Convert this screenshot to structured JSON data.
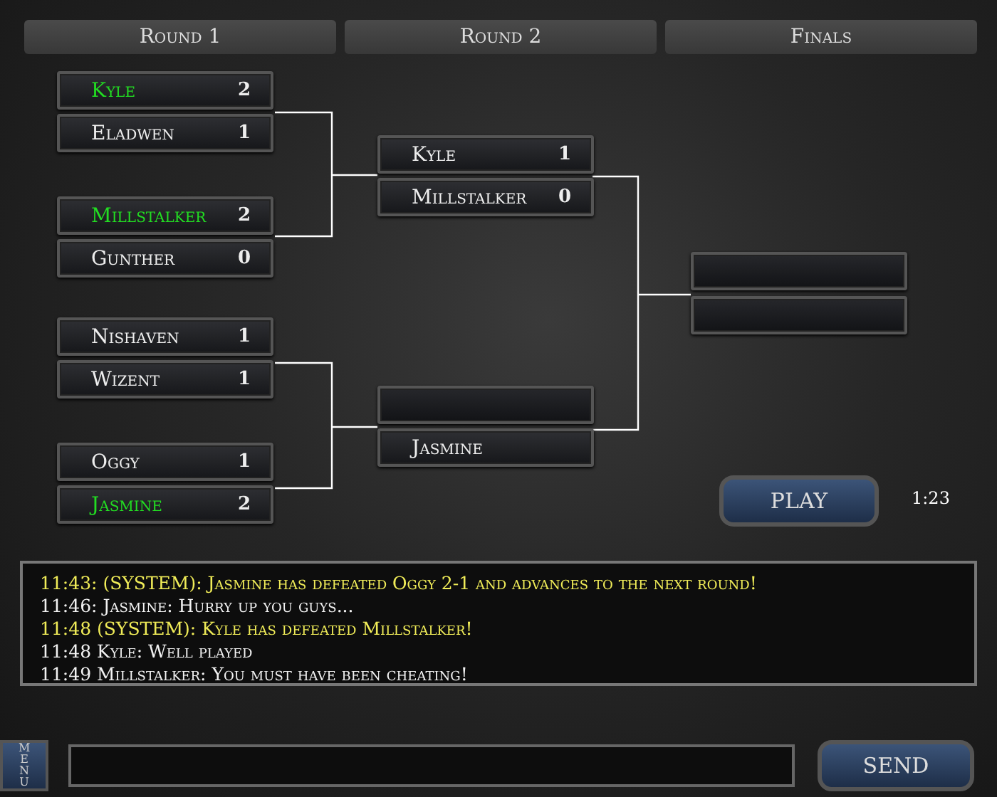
{
  "rounds": [
    {
      "title": "Round 1"
    },
    {
      "title": "Round 2"
    },
    {
      "title": "Finals"
    }
  ],
  "bracket": {
    "round_1": [
      {
        "name": "Kyle",
        "score": "2",
        "winner": true
      },
      {
        "name": "Eladwen",
        "score": "1",
        "winner": false
      },
      {
        "name": "Millstalker",
        "score": "2",
        "winner": true
      },
      {
        "name": "Gunther",
        "score": "0",
        "winner": false
      },
      {
        "name": "Nishaven",
        "score": "1",
        "winner": false
      },
      {
        "name": "Wizent",
        "score": "1",
        "winner": false
      },
      {
        "name": "Oggy",
        "score": "1",
        "winner": false
      },
      {
        "name": "Jasmine",
        "score": "2",
        "winner": true
      }
    ],
    "round_2": [
      {
        "name": "Kyle",
        "score": "1",
        "winner": false
      },
      {
        "name": "Millstalker",
        "score": "0",
        "winner": false
      },
      {
        "kind": "empty"
      },
      {
        "name": "Jasmine",
        "winner": false
      }
    ],
    "finals": [
      {
        "kind": "empty"
      },
      {
        "kind": "empty"
      }
    ]
  },
  "play_button": "PLAY",
  "timer": "1:23",
  "chat": [
    {
      "kind": "system",
      "text": "11:43: (SYSTEM): Jasmine has defeated Oggy 2-1 and advances to the next round!"
    },
    {
      "kind": "message",
      "text": "11:46: Jasmine: Hurry up you guys..."
    },
    {
      "kind": "system",
      "text": "11:48 (SYSTEM): Kyle has defeated Millstalker!"
    },
    {
      "kind": "message",
      "text": "11:48 Kyle: Well played"
    },
    {
      "kind": "message",
      "text": "11:49 Millstalker: You must have been cheating!"
    }
  ],
  "menu_button": "MENU",
  "send_button": "SEND"
}
